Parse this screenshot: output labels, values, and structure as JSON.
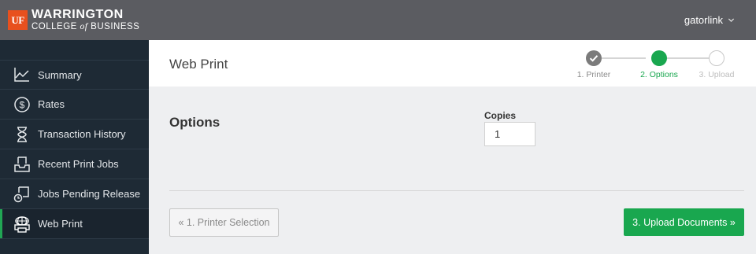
{
  "brand": {
    "mark": "UF",
    "line1": "WARRINGTON",
    "line2_pre": "COLLEGE ",
    "line2_of": "of",
    "line2_post": " BUSINESS",
    "mark_color": "#e8501e"
  },
  "user": {
    "name": "gatorlink",
    "icon": "chevron-down-icon"
  },
  "sidebar": {
    "items": [
      {
        "label": "Summary",
        "icon": "line-chart-icon",
        "active": false
      },
      {
        "label": "Rates",
        "icon": "dollar-circle-icon",
        "active": false
      },
      {
        "label": "Transaction History",
        "icon": "hourglass-icon",
        "active": false
      },
      {
        "label": "Recent Print Jobs",
        "icon": "inbox-tray-icon",
        "active": false
      },
      {
        "label": "Jobs Pending Release",
        "icon": "pending-release-icon",
        "active": false
      },
      {
        "label": "Web Print",
        "icon": "globe-printer-icon",
        "active": true
      }
    ],
    "active_color": "#21a654"
  },
  "page": {
    "title": "Web Print"
  },
  "stepper": {
    "steps": [
      {
        "label": "1. Printer",
        "state": "complete"
      },
      {
        "label": "2. Options",
        "state": "current"
      },
      {
        "label": "3. Upload",
        "state": "upcoming"
      }
    ],
    "complete_color": "#7b7b7b",
    "current_color": "#19a74f"
  },
  "options": {
    "title": "Options",
    "copies_label": "Copies",
    "copies_value": "1"
  },
  "buttons": {
    "prev_label": "« 1. Printer Selection",
    "next_label": "3. Upload Documents »",
    "next_color": "#19a74f"
  }
}
